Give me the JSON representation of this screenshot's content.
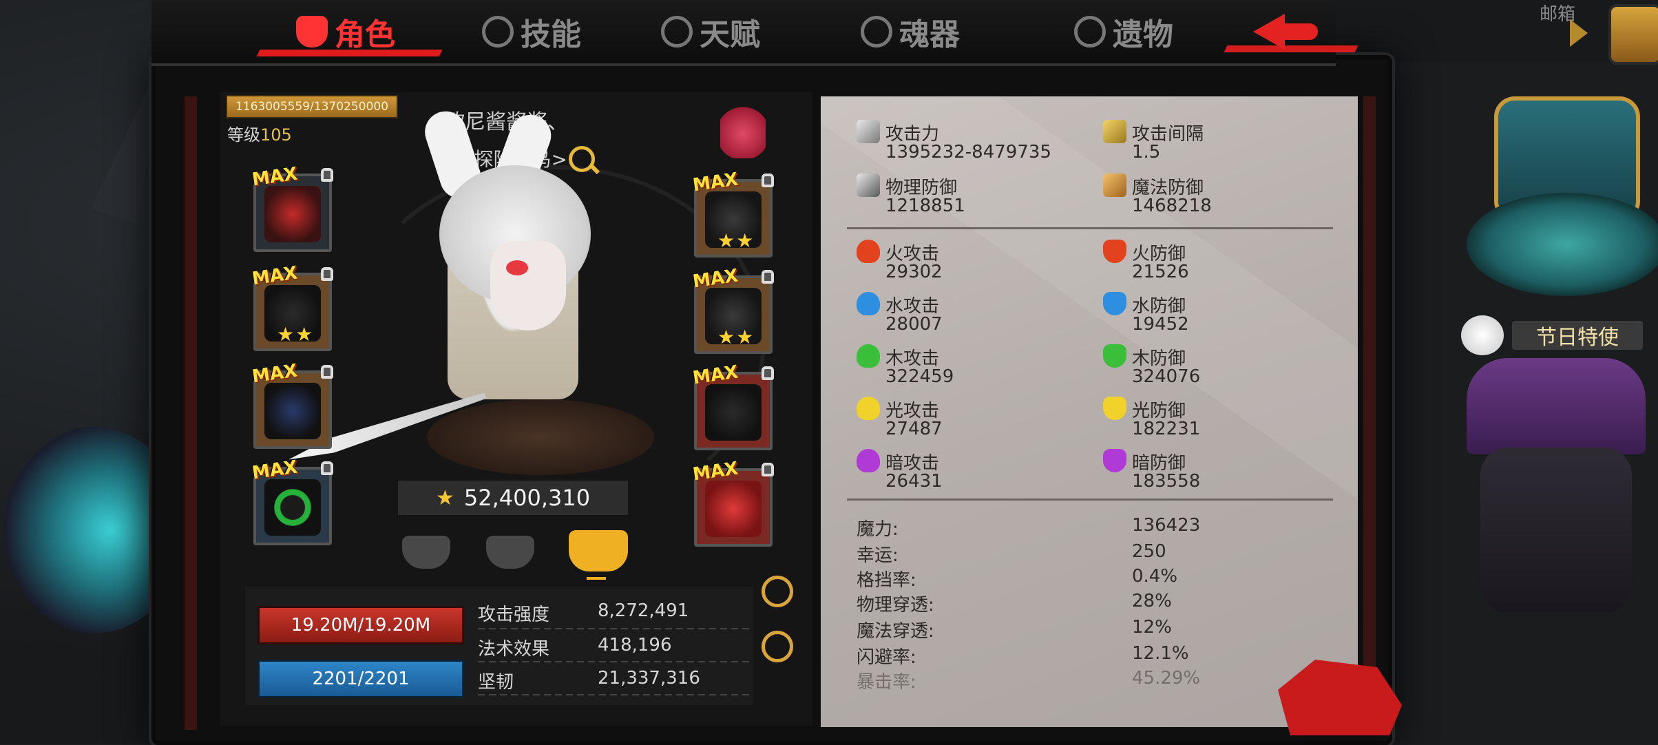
{
  "tabs": [
    {
      "label": "角色",
      "icon": "character-icon",
      "active": true
    },
    {
      "label": "技能",
      "icon": "skill-icon",
      "active": false
    },
    {
      "label": "天赋",
      "icon": "talent-icon",
      "active": false
    },
    {
      "label": "魂器",
      "icon": "soul-vessel-icon",
      "active": false
    },
    {
      "label": "遗物",
      "icon": "relic-icon",
      "active": false
    }
  ],
  "back_icon": "back-arrow-icon",
  "mail": {
    "label": "邮箱",
    "icon": "mail-chest-icon"
  },
  "character": {
    "exp_text": "1163005559/1370250000",
    "level_label": "等级",
    "level_value": "105",
    "name": "欧尼酱酱酱、",
    "title": "<探险菜鸟>",
    "power": "52,400,310"
  },
  "equipment": {
    "max_label": "MAX",
    "left": [
      {
        "name": "helmet",
        "stars": ""
      },
      {
        "name": "shoulder",
        "stars": "★★"
      },
      {
        "name": "gauntlet",
        "stars": ""
      },
      {
        "name": "ring",
        "stars": ""
      }
    ],
    "right": [
      {
        "name": "chest-armor",
        "stars": "★★"
      },
      {
        "name": "leg-armor",
        "stars": "★★"
      },
      {
        "name": "boots",
        "stars": ""
      },
      {
        "name": "amulet",
        "stars": ""
      }
    ]
  },
  "bottom_stats": {
    "hp": "19.20M/19.20M",
    "mp": "2201/2201",
    "rows": [
      {
        "label": "攻击强度",
        "value": "8,272,491"
      },
      {
        "label": "法术效果",
        "value": "418,196"
      },
      {
        "label": "坚韧",
        "value": "21,337,316"
      }
    ]
  },
  "stat_panel": {
    "top": [
      {
        "name": "攻击力",
        "value": "1395232-8479735",
        "icon": "sword-icon",
        "color": "#c9c9c9"
      },
      {
        "name": "攻击间隔",
        "value": "1.5",
        "icon": "gold-sword-icon",
        "color": "#e6c24a"
      },
      {
        "name": "物理防御",
        "value": "1218851",
        "icon": "shield-sword-icon",
        "color": "#c9c9c9"
      },
      {
        "name": "魔法防御",
        "value": "1468218",
        "icon": "magic-staff-icon",
        "color": "#e6a93a"
      }
    ],
    "elements": [
      {
        "atk_name": "火攻击",
        "atk_value": "29302",
        "def_name": "火防御",
        "def_value": "21526",
        "color": "#e2421e",
        "icon": "fire-icon"
      },
      {
        "atk_name": "水攻击",
        "atk_value": "28007",
        "def_name": "水防御",
        "def_value": "19452",
        "color": "#2e8ee0",
        "icon": "water-icon"
      },
      {
        "atk_name": "木攻击",
        "atk_value": "322459",
        "def_name": "木防御",
        "def_value": "324076",
        "color": "#3bbf3a",
        "icon": "wood-icon"
      },
      {
        "atk_name": "光攻击",
        "atk_value": "27487",
        "def_name": "光防御",
        "def_value": "182231",
        "color": "#f0d22a",
        "icon": "light-icon"
      },
      {
        "atk_name": "暗攻击",
        "atk_value": "26431",
        "def_name": "暗防御",
        "def_value": "183558",
        "color": "#b03ad6",
        "icon": "dark-icon"
      }
    ],
    "extras": [
      {
        "label": "魔力:",
        "value": "136423"
      },
      {
        "label": "幸运:",
        "value": "250"
      },
      {
        "label": "格挡率:",
        "value": "0.4%"
      },
      {
        "label": "物理穿透:",
        "value": "28%"
      },
      {
        "label": "魔法穿透:",
        "value": "12%"
      },
      {
        "label": "闪避率:",
        "value": "12.1%"
      },
      {
        "label": "暴击率:",
        "value": "45.29%"
      }
    ]
  },
  "side": {
    "festival_label": "节日特使"
  }
}
